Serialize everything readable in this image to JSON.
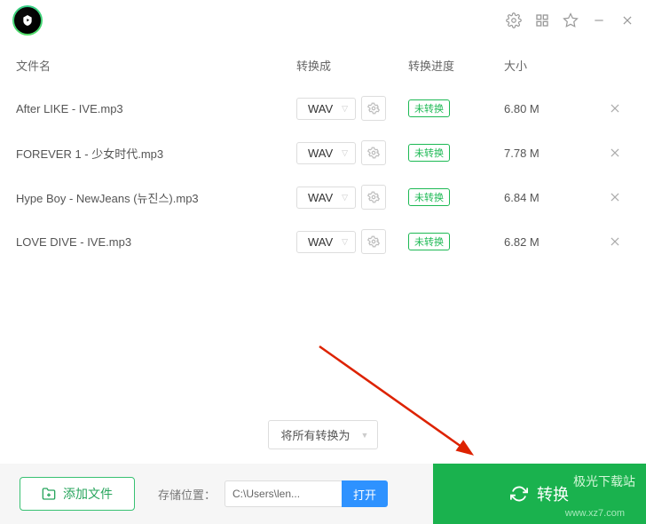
{
  "titlebar": {
    "icons": {
      "settings": "settings",
      "grid": "apps-grid",
      "star": "favorite",
      "minimize": "minimize",
      "close": "close"
    }
  },
  "columns": {
    "name": "文件名",
    "format": "转换成",
    "progress": "转换进度",
    "size": "大小"
  },
  "files": [
    {
      "name": "After LIKE - IVE.mp3",
      "format": "WAV",
      "status": "未转换",
      "size": "6.80 M"
    },
    {
      "name": "FOREVER 1 - 少女时代.mp3",
      "format": "WAV",
      "status": "未转换",
      "size": "7.78 M"
    },
    {
      "name": "Hype Boy - NewJeans (뉴진스).mp3",
      "format": "WAV",
      "status": "未转换",
      "size": "6.84 M"
    },
    {
      "name": "LOVE DIVE - IVE.mp3",
      "format": "WAV",
      "status": "未转换",
      "size": "6.82 M"
    }
  ],
  "convert_all_label": "将所有转换为",
  "bottom": {
    "add_label": "添加文件",
    "location_label": "存储位置：",
    "path_value": "C:\\Users\\len...",
    "open_label": "打开",
    "convert_label": "转换",
    "watermark": "极光下载站",
    "watermark_sub": "www.xz7.com"
  }
}
